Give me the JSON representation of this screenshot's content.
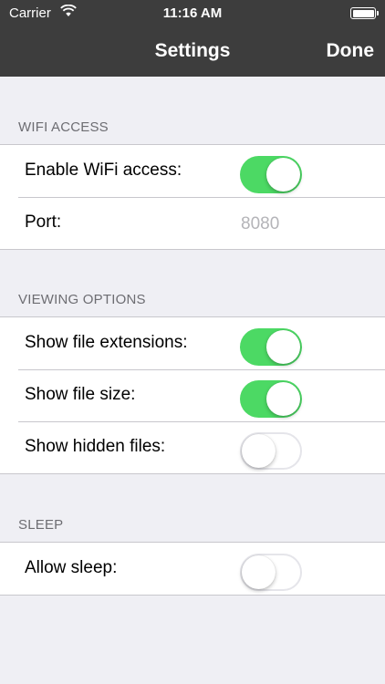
{
  "status_bar": {
    "carrier": "Carrier",
    "time": "11:16 AM",
    "wifi_icon": "wifi-icon",
    "battery_icon": "battery-icon"
  },
  "nav": {
    "title": "Settings",
    "done_label": "Done"
  },
  "sections": {
    "wifi": {
      "header": "WIFI ACCESS",
      "enable_label": "Enable WiFi access:",
      "enable_on": true,
      "port_label": "Port:",
      "port_value": "8080"
    },
    "viewing": {
      "header": "VIEWING OPTIONS",
      "extensions_label": "Show file extensions:",
      "extensions_on": true,
      "size_label": "Show file size:",
      "size_on": true,
      "hidden_label": "Show hidden files:",
      "hidden_on": false
    },
    "sleep": {
      "header": "SLEEP",
      "allow_label": "Allow sleep:",
      "allow_on": false
    }
  },
  "colors": {
    "nav_background": "#3d3d3d",
    "toggle_on": "#4cd964",
    "page_background": "#efeff4"
  }
}
